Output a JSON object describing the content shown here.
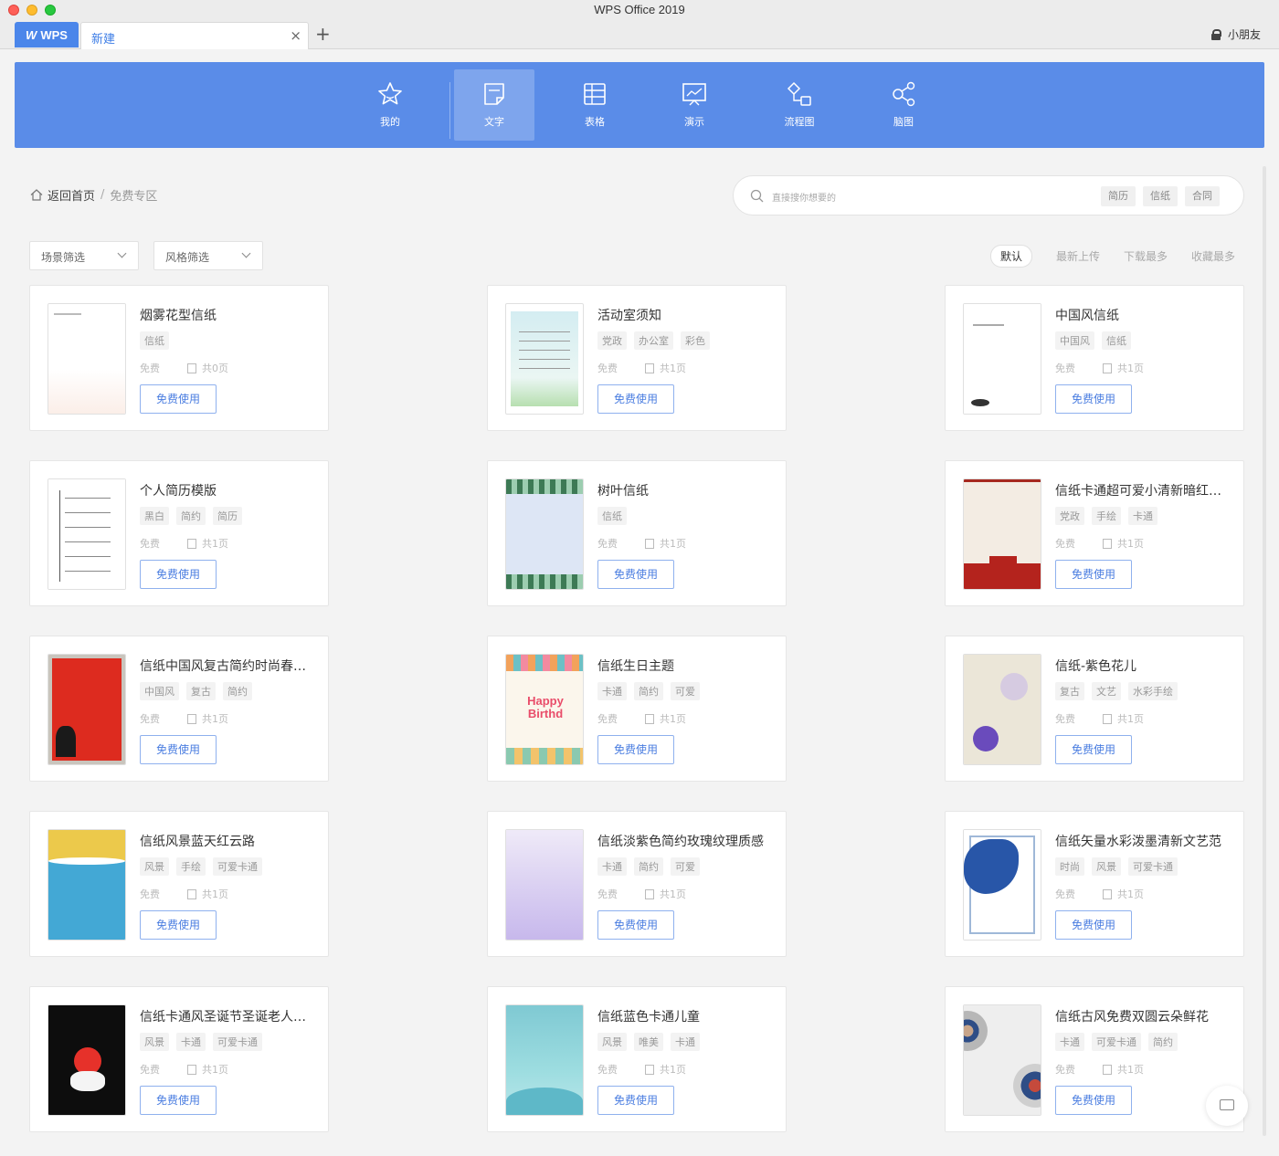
{
  "window": {
    "title": "WPS Office 2019"
  },
  "tabs": {
    "wps_label": "WPS",
    "new_tab_label": "新建",
    "close_glyph": "×",
    "plus_glyph": "+"
  },
  "user": {
    "name": "小朋友"
  },
  "categories": [
    {
      "label": "我的",
      "icon": "star-icon"
    },
    {
      "label": "文字",
      "icon": "document-icon",
      "active": true
    },
    {
      "label": "表格",
      "icon": "spreadsheet-icon"
    },
    {
      "label": "演示",
      "icon": "presentation-icon"
    },
    {
      "label": "流程图",
      "icon": "flowchart-icon"
    },
    {
      "label": "脑图",
      "icon": "mindmap-icon"
    }
  ],
  "breadcrumb": {
    "home": "返回首页",
    "separator": "/",
    "current": "免费专区"
  },
  "search": {
    "placeholder": "直接搜你想要的",
    "tags": [
      "简历",
      "信纸",
      "合同"
    ]
  },
  "filters": {
    "scene": "场景筛选",
    "style": "风格筛选"
  },
  "sort": {
    "options": [
      "默认",
      "最新上传",
      "下载最多",
      "收藏最多"
    ],
    "active": "默认"
  },
  "card_common": {
    "price": "免费",
    "button": "免费使用"
  },
  "templates": [
    {
      "title": "烟雾花型信纸",
      "tags": [
        "信纸"
      ],
      "pages": "共0页"
    },
    {
      "title": "活动室须知",
      "tags": [
        "党政",
        "办公室",
        "彩色"
      ],
      "pages": "共1页"
    },
    {
      "title": "中国风信纸",
      "tags": [
        "中国风",
        "信纸"
      ],
      "pages": "共1页"
    },
    {
      "title": "个人简历模版",
      "tags": [
        "黑白",
        "简约",
        "简历"
      ],
      "pages": "共1页"
    },
    {
      "title": "树叶信纸",
      "tags": [
        "信纸"
      ],
      "pages": "共1页"
    },
    {
      "title": "信纸卡通超可爱小清新暗红…",
      "tags": [
        "党政",
        "手绘",
        "卡通"
      ],
      "pages": "共1页"
    },
    {
      "title": "信纸中国风复古简约时尚春…",
      "tags": [
        "中国风",
        "复古",
        "简约"
      ],
      "pages": "共1页"
    },
    {
      "title": "信纸生日主题",
      "tags": [
        "卡通",
        "简约",
        "可爱"
      ],
      "pages": "共1页"
    },
    {
      "title": "信纸-紫色花儿",
      "tags": [
        "复古",
        "文艺",
        "水彩手绘"
      ],
      "pages": "共1页"
    },
    {
      "title": "信纸风景蓝天红云路",
      "tags": [
        "风景",
        "手绘",
        "可爱卡通"
      ],
      "pages": "共1页"
    },
    {
      "title": "信纸淡紫色简约玫瑰纹理质感",
      "tags": [
        "卡通",
        "简约",
        "可爱"
      ],
      "pages": "共1页"
    },
    {
      "title": "信纸矢量水彩泼墨清新文艺范",
      "tags": [
        "时尚",
        "风景",
        "可爱卡通"
      ],
      "pages": "共1页"
    },
    {
      "title": "信纸卡通风圣诞节圣诞老人…",
      "tags": [
        "风景",
        "卡通",
        "可爱卡通"
      ],
      "pages": "共1页"
    },
    {
      "title": "信纸蓝色卡通儿童",
      "tags": [
        "风景",
        "唯美",
        "卡通"
      ],
      "pages": "共1页"
    },
    {
      "title": "信纸古风免费双圆云朵鲜花",
      "tags": [
        "卡通",
        "可爱卡通",
        "简约"
      ],
      "pages": "共1页"
    }
  ],
  "thumb_texts": {
    "birthday_line1": "Happy",
    "birthday_line2": "Birthd"
  },
  "colors": {
    "accent": "#5a8ce8",
    "link": "#4a7de0",
    "wps_brand": "#4b86ea"
  }
}
